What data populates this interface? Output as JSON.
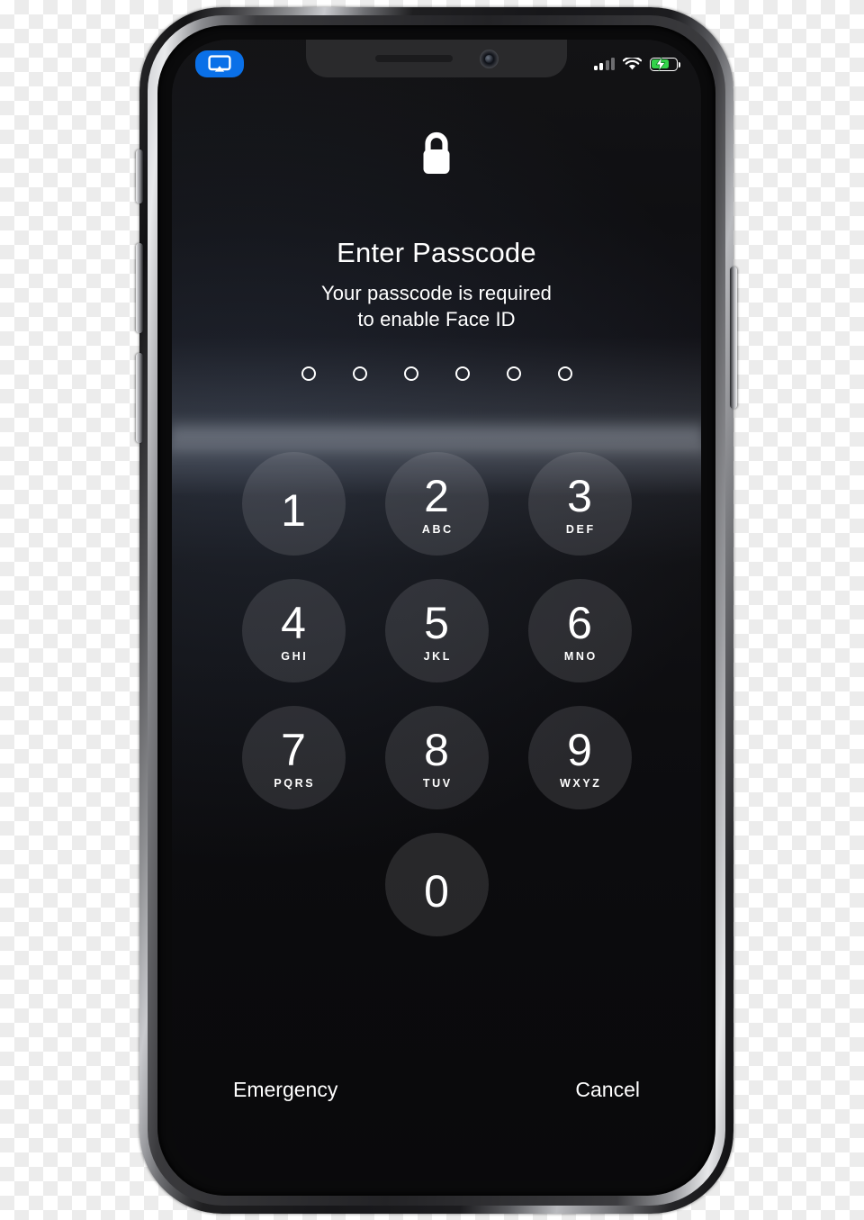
{
  "device": {
    "type": "smartphone",
    "frame_color": "#1b1b1e",
    "accent_color": "#0a70e8"
  },
  "status_bar": {
    "airplay_badge": {
      "icon": "airplay-icon",
      "active": true,
      "color": "#0a70e8"
    },
    "signal": {
      "icon": "cellular-signal-icon",
      "bars_total": 4,
      "bars_filled": 2
    },
    "wifi": {
      "icon": "wifi-icon",
      "strength": "full"
    },
    "battery": {
      "icon": "battery-charging-icon",
      "charging": true,
      "level_percent": 72,
      "color": "#34d24a"
    }
  },
  "notch": {
    "speaker": "earpiece-speaker",
    "camera": "front-camera-icon"
  },
  "lock_screen": {
    "lock_icon": "lock-closed-icon",
    "title": "Enter Passcode",
    "subtitle_line1": "Your passcode is required",
    "subtitle_line2": "to enable Face ID",
    "passcode": {
      "length": 6,
      "entered": 0,
      "dots": [
        false,
        false,
        false,
        false,
        false,
        false
      ]
    },
    "keypad": [
      [
        {
          "digit": "1",
          "letters": ""
        },
        {
          "digit": "2",
          "letters": "ABC"
        },
        {
          "digit": "3",
          "letters": "DEF"
        }
      ],
      [
        {
          "digit": "4",
          "letters": "GHI"
        },
        {
          "digit": "5",
          "letters": "JKL"
        },
        {
          "digit": "6",
          "letters": "MNO"
        }
      ],
      [
        {
          "digit": "7",
          "letters": "PQRS"
        },
        {
          "digit": "8",
          "letters": "TUV"
        },
        {
          "digit": "9",
          "letters": "WXYZ"
        }
      ],
      [
        {
          "digit": "0",
          "letters": ""
        }
      ]
    ],
    "actions": {
      "emergency_label": "Emergency",
      "cancel_label": "Cancel"
    }
  },
  "hardware_buttons": {
    "mute_switch": "mute-switch",
    "volume_up": "volume-up-button",
    "volume_down": "volume-down-button",
    "power": "side-power-button"
  }
}
